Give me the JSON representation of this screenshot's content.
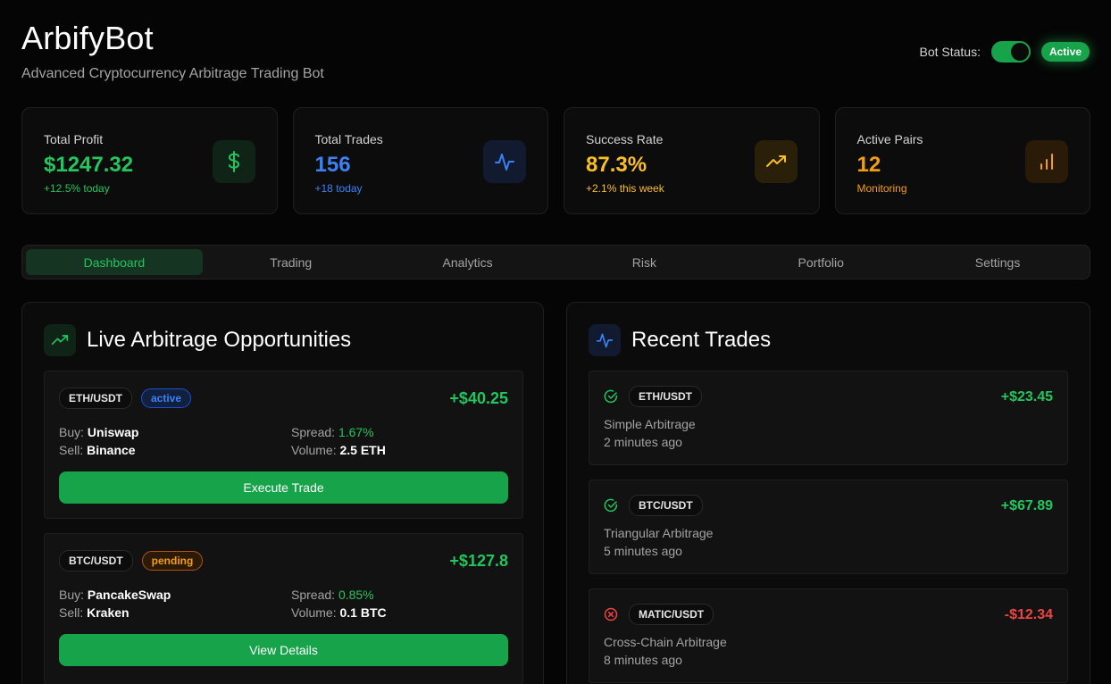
{
  "header": {
    "title": "ArbifyBot",
    "subtitle": "Advanced Cryptocurrency Arbitrage Trading Bot",
    "status_label": "Bot Status:",
    "status_badge": "Active"
  },
  "stats": [
    {
      "label": "Total Profit",
      "value": "$1247.32",
      "sub": "+12.5% today",
      "icon": "dollar-icon",
      "color": "#22c55e"
    },
    {
      "label": "Total Trades",
      "value": "156",
      "sub": "+18 today",
      "icon": "activity-icon",
      "color": "#3b82f6"
    },
    {
      "label": "Success Rate",
      "value": "87.3%",
      "sub": "+2.1% this week",
      "icon": "trending-up-icon",
      "color": "#fbbf24"
    },
    {
      "label": "Active Pairs",
      "value": "12",
      "sub": "Monitoring",
      "icon": "bar-chart-icon",
      "color": "#f59e0b"
    }
  ],
  "tabs": [
    {
      "label": "Dashboard",
      "active": true
    },
    {
      "label": "Trading"
    },
    {
      "label": "Analytics"
    },
    {
      "label": "Risk"
    },
    {
      "label": "Portfolio"
    },
    {
      "label": "Settings"
    }
  ],
  "opportunities": {
    "title": "Live Arbitrage Opportunities",
    "items": [
      {
        "pair": "ETH/USDT",
        "status": "active",
        "profit": "+$40.25",
        "buy_label": "Buy:",
        "buy": "Uniswap",
        "sell_label": "Sell:",
        "sell": "Binance",
        "spread_label": "Spread:",
        "spread": "1.67%",
        "volume_label": "Volume:",
        "volume": "2.5 ETH",
        "action": "Execute Trade"
      },
      {
        "pair": "BTC/USDT",
        "status": "pending",
        "profit": "+$127.8",
        "buy_label": "Buy:",
        "buy": "PancakeSwap",
        "sell_label": "Sell:",
        "sell": "Kraken",
        "spread_label": "Spread:",
        "spread": "0.85%",
        "volume_label": "Volume:",
        "volume": "0.1 BTC",
        "action": "View Details"
      }
    ]
  },
  "recent_trades": {
    "title": "Recent Trades",
    "items": [
      {
        "pair": "ETH/USDT",
        "result": "success",
        "amount": "+$23.45",
        "type": "Simple Arbitrage",
        "time": "2 minutes ago"
      },
      {
        "pair": "BTC/USDT",
        "result": "success",
        "amount": "+$67.89",
        "type": "Triangular Arbitrage",
        "time": "5 minutes ago"
      },
      {
        "pair": "MATIC/USDT",
        "result": "failed",
        "amount": "-$12.34",
        "type": "Cross-Chain Arbitrage",
        "time": "8 minutes ago"
      }
    ]
  },
  "colors": {
    "accent_green": "#22c55e",
    "button_green": "#16a34a",
    "blue": "#3b82f6",
    "amber": "#fbbf24",
    "orange": "#f59e0b",
    "red": "#ef4444",
    "background": "#050505"
  }
}
